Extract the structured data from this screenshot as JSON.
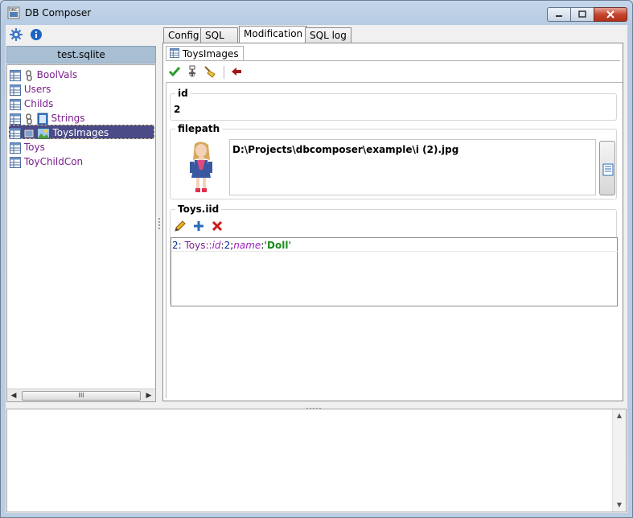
{
  "window": {
    "title": "DB Composer",
    "buttons": [
      "minimize",
      "maximize",
      "close"
    ]
  },
  "left_panel": {
    "toolbar_icons": [
      "gear-icon",
      "info-icon"
    ],
    "db_name": "test.sqlite",
    "tree": [
      {
        "label": "BoolVals",
        "icons": [
          "table-icon",
          "link-icon"
        ],
        "selected": false
      },
      {
        "label": "Users",
        "icons": [
          "table-icon"
        ],
        "selected": false
      },
      {
        "label": "Childs",
        "icons": [
          "table-icon"
        ],
        "selected": false
      },
      {
        "label": "Strings",
        "icons": [
          "table-icon",
          "link-icon",
          "book-icon"
        ],
        "selected": false
      },
      {
        "label": "ToysImages",
        "icons": [
          "table-icon",
          "picture-icon",
          "image-icon"
        ],
        "selected": true
      },
      {
        "label": "Toys",
        "icons": [
          "table-icon"
        ],
        "selected": false
      },
      {
        "label": "ToyChildCon",
        "icons": [
          "table-icon"
        ],
        "selected": false
      }
    ],
    "scroll_thumb": "III"
  },
  "tabs": [
    {
      "label": "Config",
      "active": false
    },
    {
      "label": "SQL",
      "active": false
    },
    {
      "label": "Modification",
      "active": true
    },
    {
      "label": "SQL log",
      "active": false
    }
  ],
  "editor": {
    "subtab_label": "ToysImages",
    "actions": [
      "apply-icon",
      "insert-icon",
      "clear-icon",
      "back-icon"
    ],
    "fields": {
      "id": {
        "label": "id",
        "value": "2"
      },
      "filepath": {
        "label": "filepath",
        "value": "D:\\Projects\\dbcomposer\\example\\i (2).jpg"
      }
    },
    "relation": {
      "label": "Toys.iid",
      "actions": [
        "edit-icon",
        "add-icon",
        "delete-icon"
      ],
      "rows": [
        {
          "prefix": "2: ",
          "table": "Toys",
          "sep1": "::",
          "key1": "id",
          "colon1": ":",
          "val1": "2",
          "sep2": ";",
          "key2": "name",
          "colon2": ":",
          "val2": "'Doll'"
        }
      ]
    }
  },
  "colors": {
    "tree_text": "#7b1f8c",
    "selection": "#4b4b88",
    "key_text": "#a020c0",
    "string_text": "#1a8a1a",
    "close_button": "#c4452e"
  }
}
